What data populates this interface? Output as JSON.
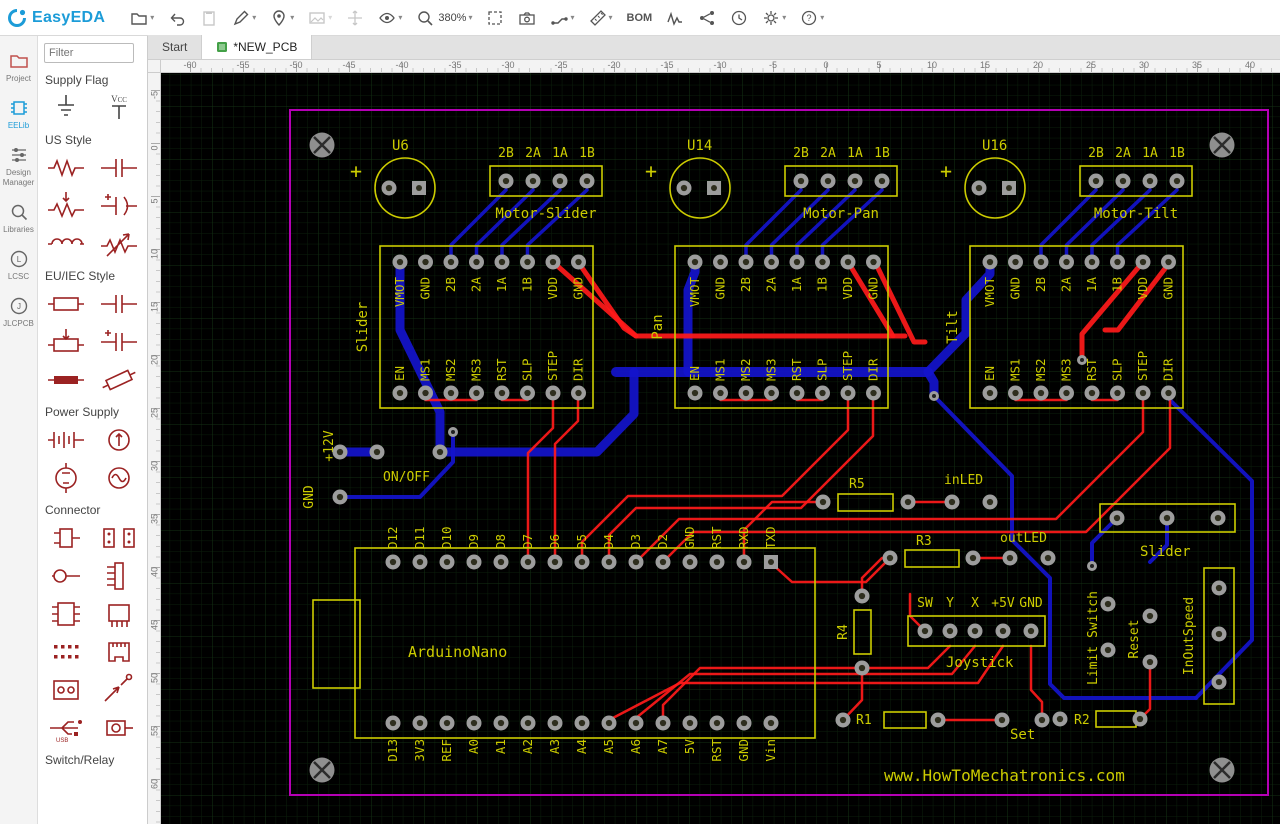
{
  "toolbar": {
    "logo_text": "EasyEDA",
    "zoom_level": "380%",
    "bom_label": "BOM"
  },
  "tabs": {
    "start": "Start",
    "active": "*NEW_PCB"
  },
  "sidebar": {
    "items": [
      {
        "label": "Project"
      },
      {
        "label": "EELib"
      },
      {
        "label": "Design Manager"
      },
      {
        "label": "Libraries"
      },
      {
        "label": "LCSC"
      },
      {
        "label": "JLCPCB"
      }
    ]
  },
  "library": {
    "filter_placeholder": "Filter",
    "sections": [
      {
        "title": "Supply Flag",
        "icons": [
          "ground",
          "vcc"
        ]
      },
      {
        "title": "US Style",
        "icons": [
          "resistor-us",
          "capacitor",
          "potentiometer-us",
          "capacitor-polarized",
          "inductor",
          "resistor-variable"
        ]
      },
      {
        "title": "EU/IEC Style",
        "icons": [
          "resistor-eu",
          "capacitor-2",
          "potentiometer-eu",
          "capacitor-polarized-2",
          "resistor-filled",
          "resistor-trimmer"
        ]
      },
      {
        "title": "Power Supply",
        "icons": [
          "battery",
          "source-current",
          "source-voltage",
          "source-ac"
        ]
      },
      {
        "title": "Connector",
        "icons": [
          "conn-plug",
          "conn-header-pair",
          "conn-socket",
          "conn-header",
          "conn-ic",
          "conn-ic-2",
          "conn-pin-grid",
          "conn-rj45",
          "conn-terminal",
          "conn-probe",
          "conn-usb",
          "conn-audio"
        ]
      },
      {
        "title": "Switch/Relay",
        "icons": []
      }
    ]
  },
  "rulers": {
    "h": [
      "-60",
      "-55",
      "-50",
      "-45",
      "-40",
      "-35",
      "-30",
      "-25",
      "-20",
      "-15",
      "-10",
      "-5",
      "0",
      "5",
      "10",
      "15",
      "20",
      "25",
      "30",
      "35",
      "40"
    ],
    "v": [
      "-5",
      "0",
      "5",
      "10",
      "15",
      "20",
      "25",
      "30",
      "35",
      "40",
      "45",
      "50",
      "55",
      "60"
    ]
  },
  "pcb": {
    "drivers": [
      {
        "ref": "U6",
        "name": "Slider",
        "motor_label": "Motor-Slider"
      },
      {
        "ref": "U14",
        "name": "Pan",
        "motor_label": "Motor-Pan"
      },
      {
        "ref": "U16",
        "name": "Tilt",
        "motor_label": "Motor-Tilt"
      }
    ],
    "driver_pins_top": [
      "VMOT",
      "GND",
      "2B",
      "2A",
      "1A",
      "1B",
      "VDD",
      "GND"
    ],
    "driver_pins_bottom": [
      "EN",
      "MS1",
      "MS2",
      "MS3",
      "RST",
      "SLP",
      "STEP",
      "DIR"
    ],
    "motor_pins": [
      "2B",
      "2A",
      "1A",
      "1B"
    ],
    "arduino": {
      "name": "ArduinoNano",
      "pins_top": [
        "D12",
        "D11",
        "D10",
        "D9",
        "D8",
        "D7",
        "D6",
        "D5",
        "D4",
        "D3",
        "D2",
        "GND",
        "RST",
        "RXD",
        "TXD"
      ],
      "pins_bottom": [
        "D13",
        "3V3",
        "REF",
        "A0",
        "A1",
        "A2",
        "A3",
        "A4",
        "A5",
        "A6",
        "A7",
        "5V",
        "RST",
        "GND",
        "Vin"
      ]
    },
    "joystick": {
      "name": "Joystick",
      "pins": [
        "SW",
        "Y",
        "X",
        "+5V",
        "GND"
      ]
    },
    "resistors": [
      "R5",
      "R3",
      "R4",
      "R1",
      "R2"
    ],
    "labels": {
      "on_off": "ON/OFF",
      "plus12v": "+12V",
      "gnd": "GND",
      "in_led": "inLED",
      "out_led": "outLED",
      "set": "Set",
      "slider_conn": "Slider",
      "limit_switch": "Limit Switch",
      "reset": "Reset",
      "in_out_speed": "InOutSpeed",
      "website": "www.HowToMechatronics.com"
    }
  },
  "colors": {
    "silk": "#CCCC00",
    "top_trace": "#FF1A1A",
    "bottom_trace": "#1414CC",
    "board_outline": "#B400B4",
    "accent": "#1C9CD8"
  }
}
